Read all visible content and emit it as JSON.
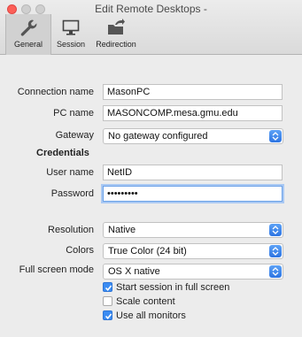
{
  "window": {
    "title": "Edit Remote Desktops -"
  },
  "tabs": [
    {
      "label": "General",
      "icon": "wrench-icon",
      "active": true
    },
    {
      "label": "Session",
      "icon": "monitor-icon",
      "active": false
    },
    {
      "label": "Redirection",
      "icon": "folder-share-icon",
      "active": false
    }
  ],
  "general": {
    "connection_name": {
      "label": "Connection name",
      "value": "MasonPC"
    },
    "pc_name": {
      "label": "PC name",
      "value": "MASONCOMP.mesa.gmu.edu"
    },
    "gateway": {
      "label": "Gateway",
      "value": "No gateway configured"
    },
    "credentials_title": "Credentials",
    "user_name": {
      "label": "User name",
      "value": "NetID"
    },
    "password": {
      "label": "Password",
      "value": "•••••••••"
    },
    "resolution": {
      "label": "Resolution",
      "value": "Native"
    },
    "colors": {
      "label": "Colors",
      "value": "True Color (24 bit)"
    },
    "full_screen_mode": {
      "label": "Full screen mode",
      "value": "OS X native"
    },
    "checkboxes": [
      {
        "label": "Start session in full screen",
        "checked": true
      },
      {
        "label": "Scale content",
        "checked": false
      },
      {
        "label": "Use all monitors",
        "checked": true
      }
    ]
  },
  "colors": {
    "accent": "#3b8cf2",
    "close": "#fc5f57"
  }
}
